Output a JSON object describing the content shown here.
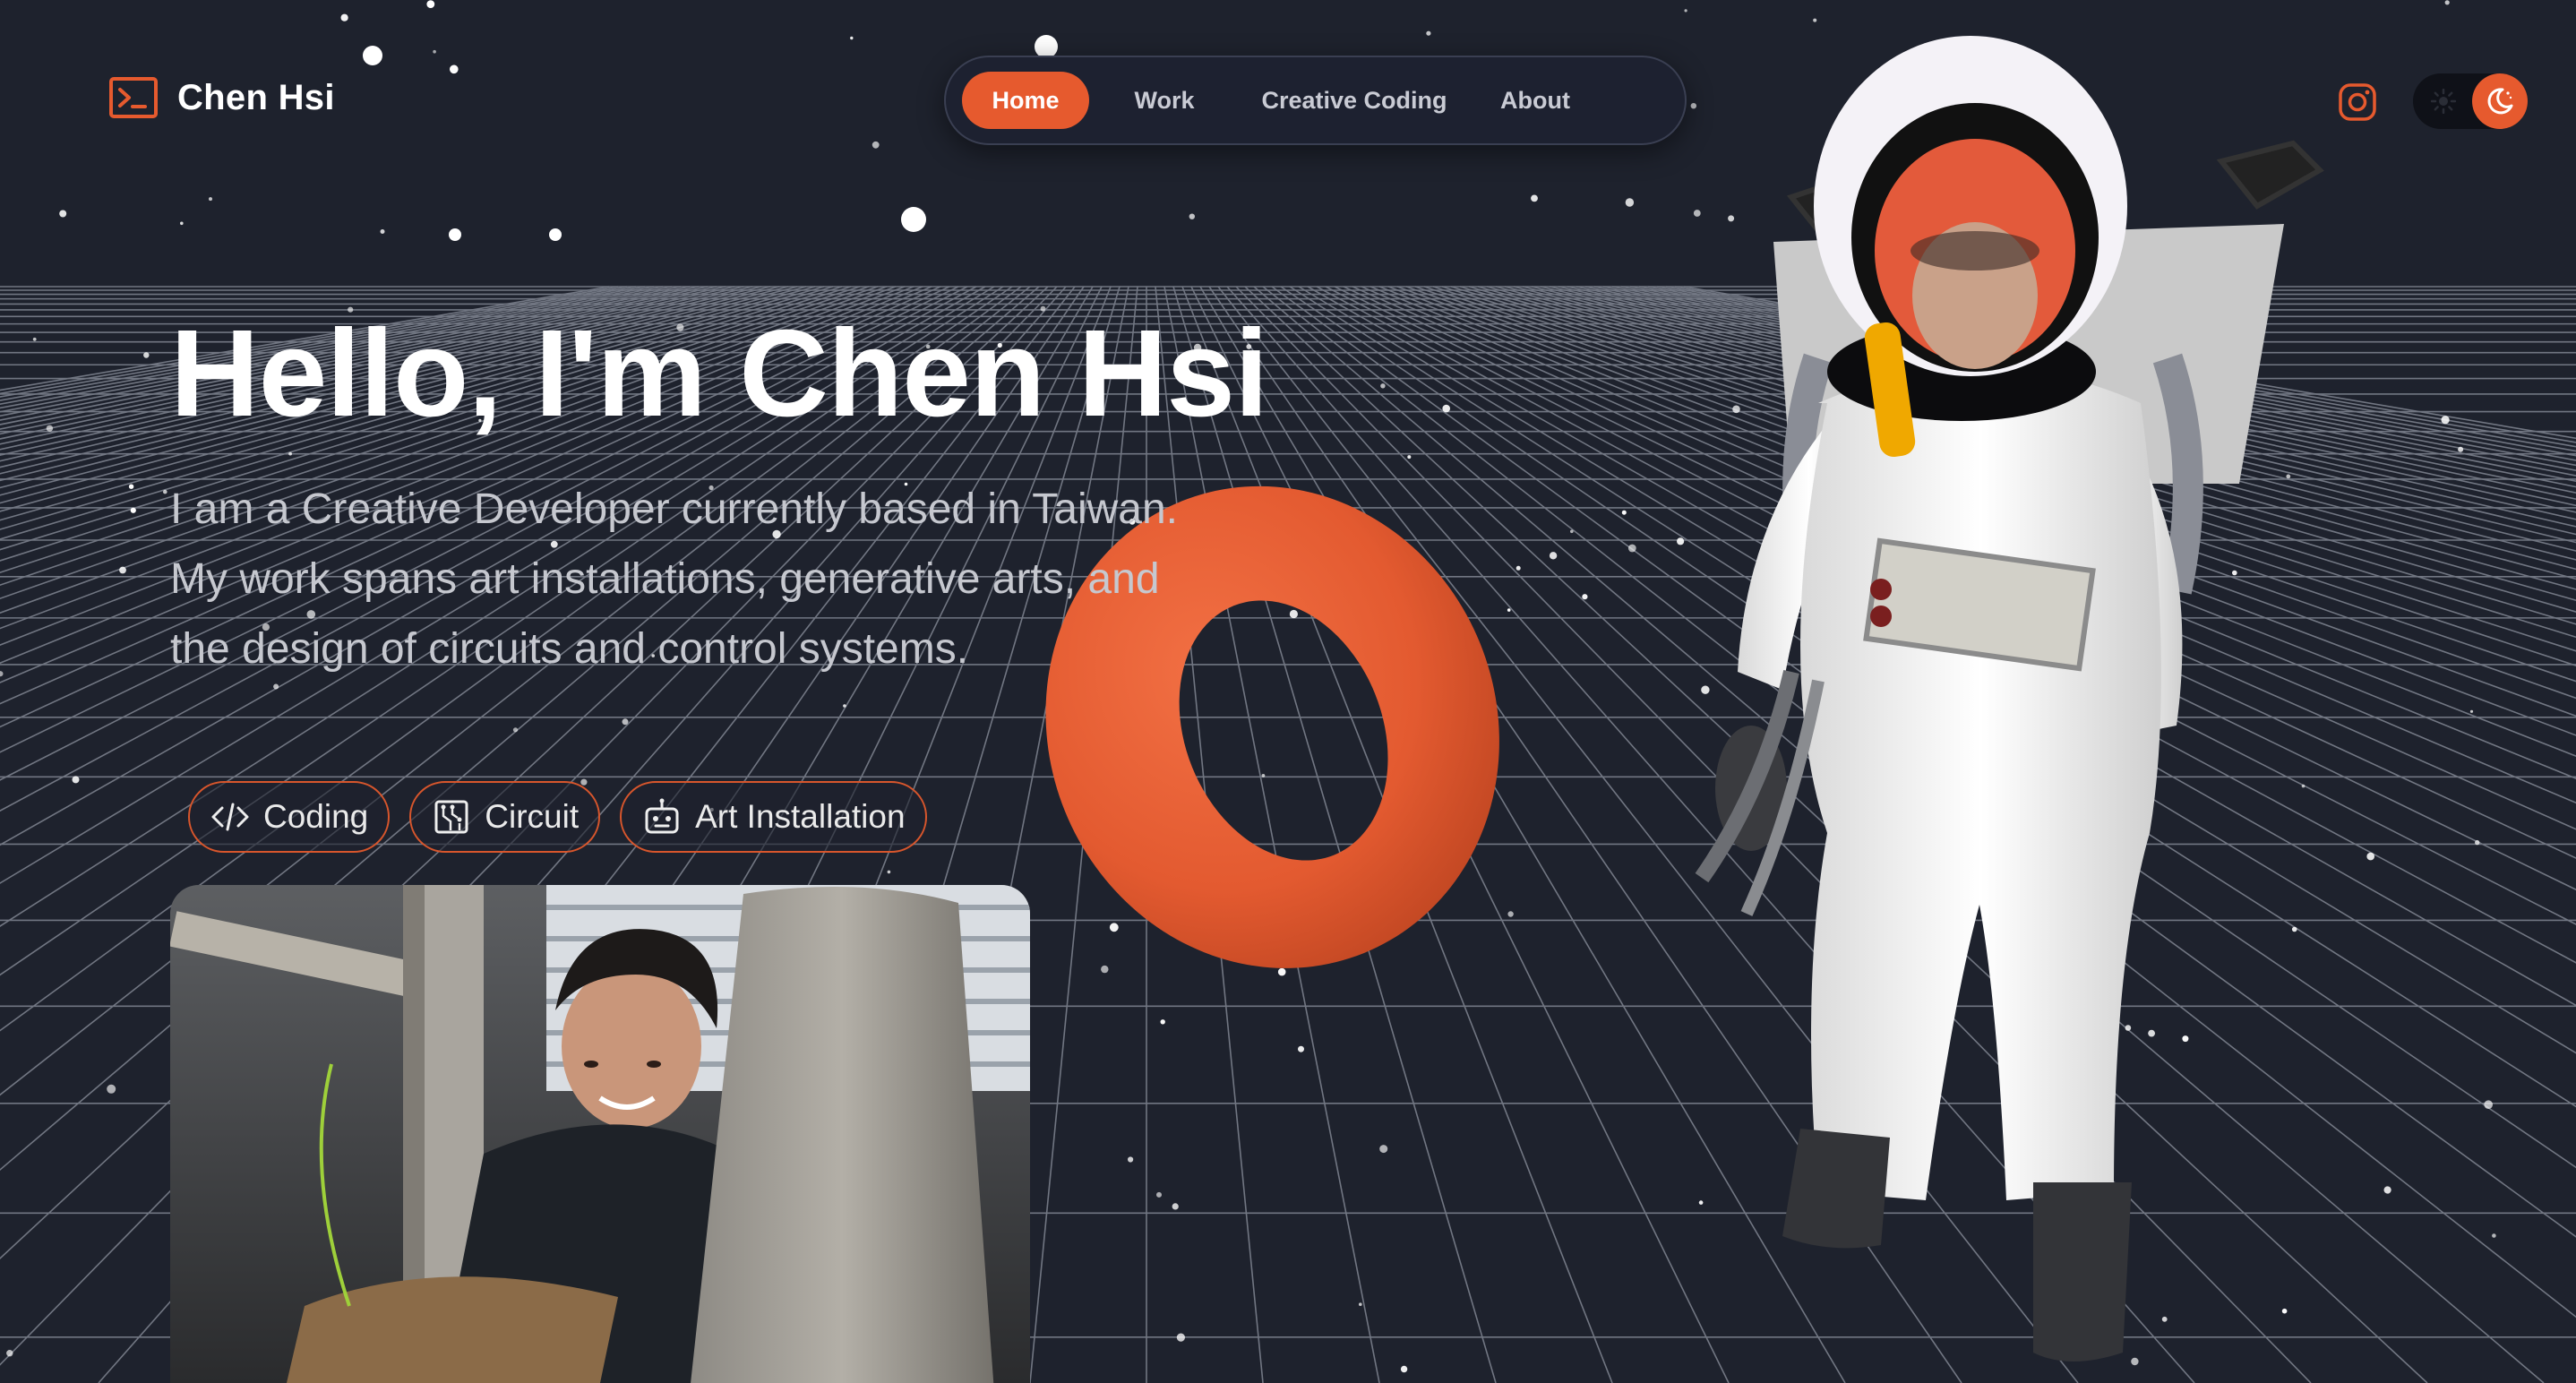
{
  "brand": {
    "name": "Chen Hsi",
    "icon": "terminal-icon",
    "accent": "#e65a2e"
  },
  "nav": {
    "items": [
      {
        "label": "Home",
        "active": true
      },
      {
        "label": "Work",
        "active": false
      },
      {
        "label": "Creative Coding",
        "active": false
      },
      {
        "label": "About",
        "active": false
      }
    ]
  },
  "header_actions": {
    "social_icon": "instagram-icon",
    "theme": "dark"
  },
  "hero": {
    "title": "Hello, I'm Chen Hsi",
    "description": "I am a Creative Developer currently based in Taiwan. My work spans art installations, generative arts, and the design of circuits and control systems.",
    "tags": [
      {
        "label": "Coding",
        "icon": "code-icon"
      },
      {
        "label": "Circuit",
        "icon": "circuit-icon"
      },
      {
        "label": "Art Installation",
        "icon": "robot-icon"
      }
    ]
  },
  "colors": {
    "background": "#1e222d",
    "accent": "#e65a2e",
    "grid": "#aab0bd"
  }
}
